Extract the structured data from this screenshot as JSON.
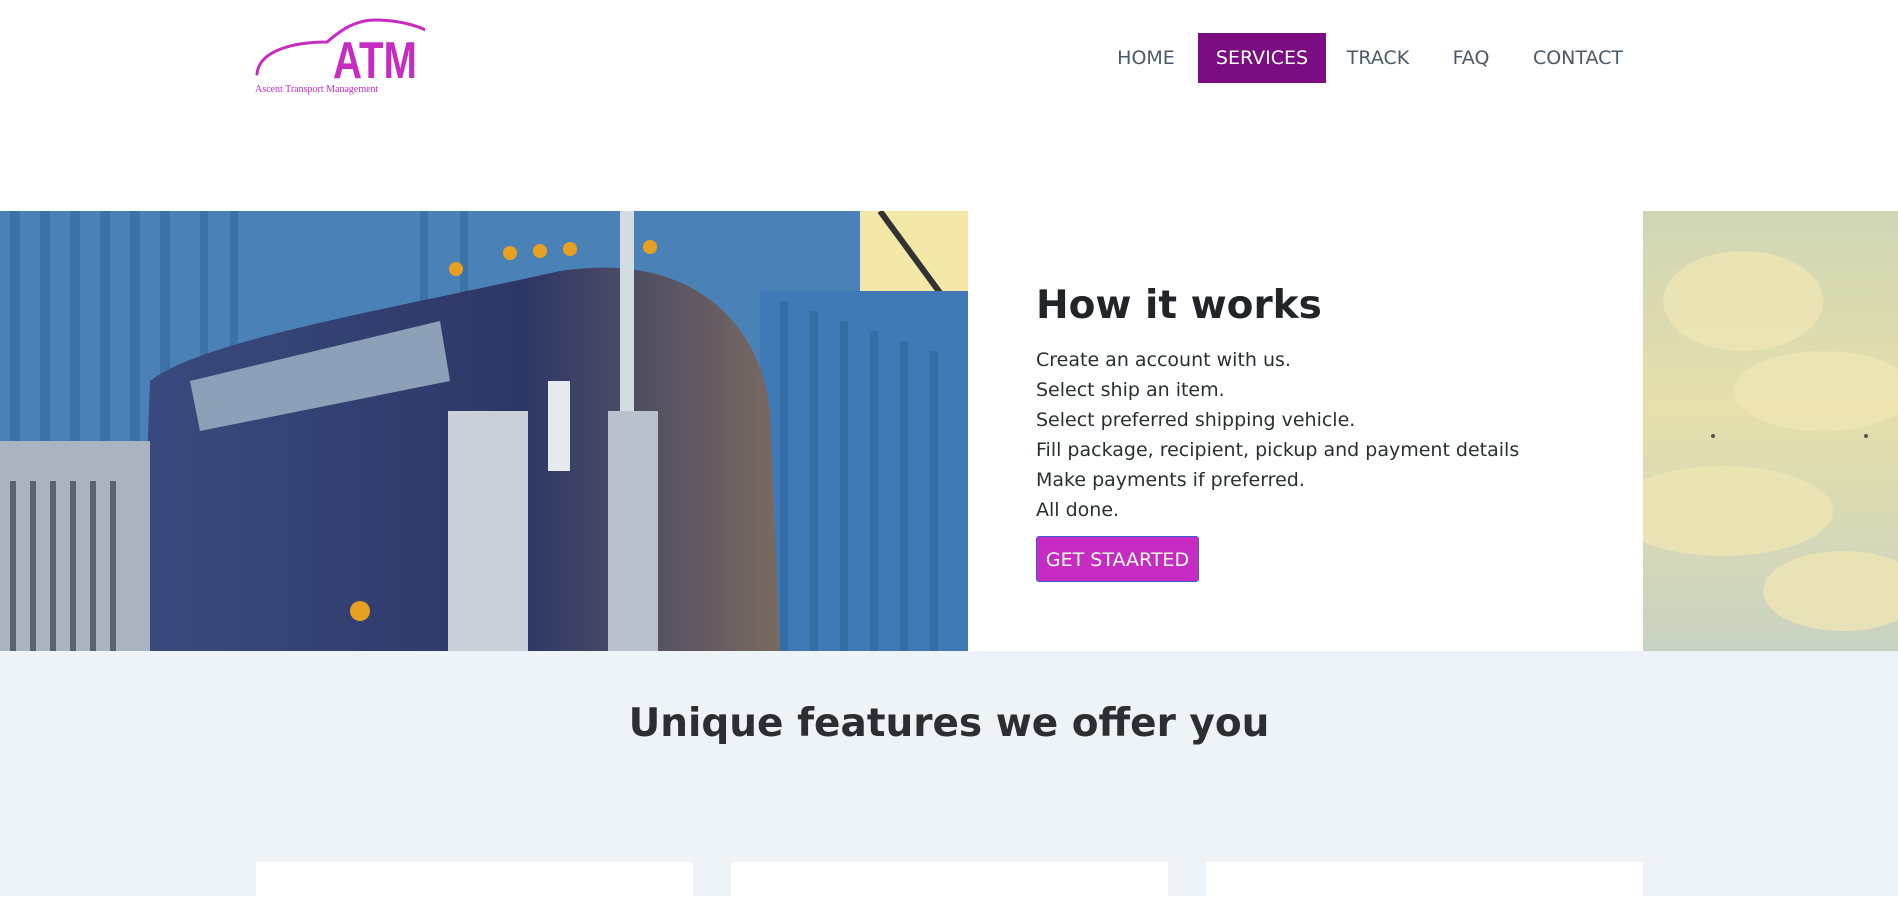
{
  "brand": {
    "logo_text": "ATM",
    "logo_tagline": "Ascent Transport Management",
    "color": "#c62cc1"
  },
  "nav": {
    "items": [
      {
        "label": "HOME",
        "active": false
      },
      {
        "label": "SERVICES",
        "active": true
      },
      {
        "label": "TRACK",
        "active": false
      },
      {
        "label": "FAQ",
        "active": false
      },
      {
        "label": "CONTACT",
        "active": false
      }
    ],
    "active_color": "#7b0c82"
  },
  "hero": {
    "title": "How it works",
    "steps": [
      "Create an account with us.",
      "Select ship an item.",
      "Select preferred shipping vehicle.",
      "Fill package, recipient, pickup and payment details",
      "Make payments if preferred.",
      "All done."
    ],
    "cta_label": "GET STAARTED",
    "image_left": "truck-photo",
    "image_right": "sky-photo"
  },
  "features": {
    "title": "Unique features we offer you",
    "background": "#eef3f7"
  }
}
